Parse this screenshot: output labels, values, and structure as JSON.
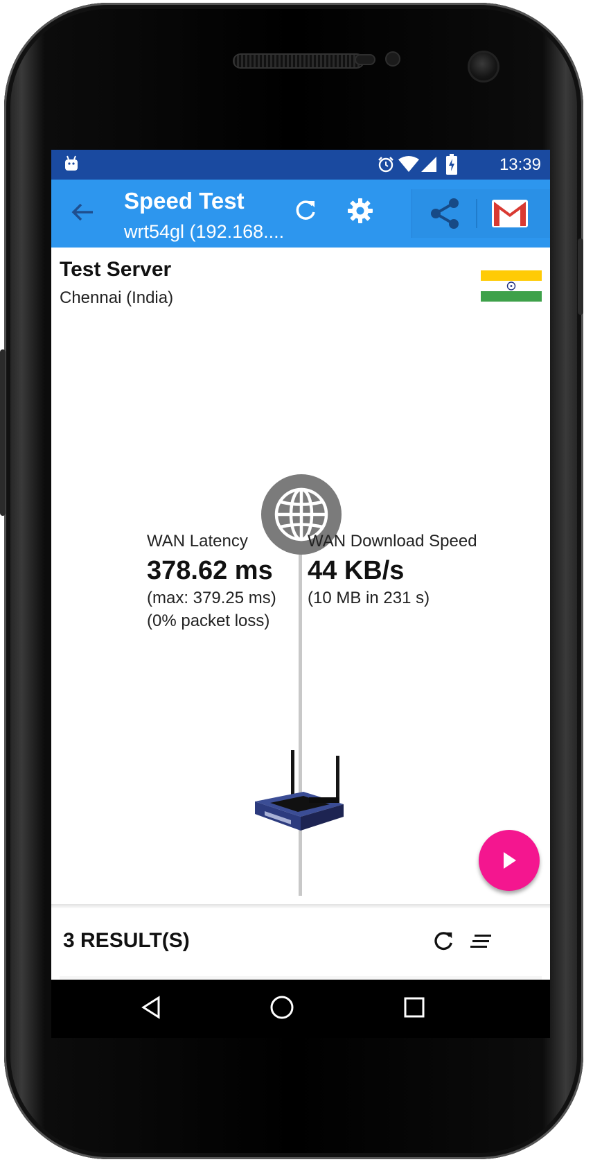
{
  "status_bar": {
    "time": "13:39"
  },
  "app_bar": {
    "title": "Speed Test",
    "subtitle": "wrt54gl (192.168...."
  },
  "server": {
    "heading": "Test Server",
    "location": "Chennai (India)"
  },
  "latency": {
    "label": "WAN Latency",
    "value": "378.62 ms",
    "max": "(max: 379.25 ms)",
    "packet_loss": "(0% packet loss)"
  },
  "download": {
    "label": "WAN Download Speed",
    "value": "44 KB/s",
    "detail": "(10 MB in 231 s)"
  },
  "results": {
    "label": "3 RESULT(S)"
  },
  "colors": {
    "status_bar": "#1a4aa0",
    "app_bar": "#2d96ee",
    "fab": "#f4168f",
    "globe_circle": "#7b7b7b"
  },
  "icons": [
    "android-icon",
    "alarm-icon",
    "wifi-icon",
    "signal-icon",
    "battery-charging-icon",
    "back-arrow-icon",
    "refresh-icon",
    "settings-gear-icon",
    "share-icon",
    "gmail-icon",
    "india-flag-icon",
    "globe-icon",
    "router-icon",
    "play-icon",
    "results-refresh-icon",
    "sort-icon",
    "nav-back-icon",
    "nav-home-icon",
    "nav-recents-icon"
  ]
}
